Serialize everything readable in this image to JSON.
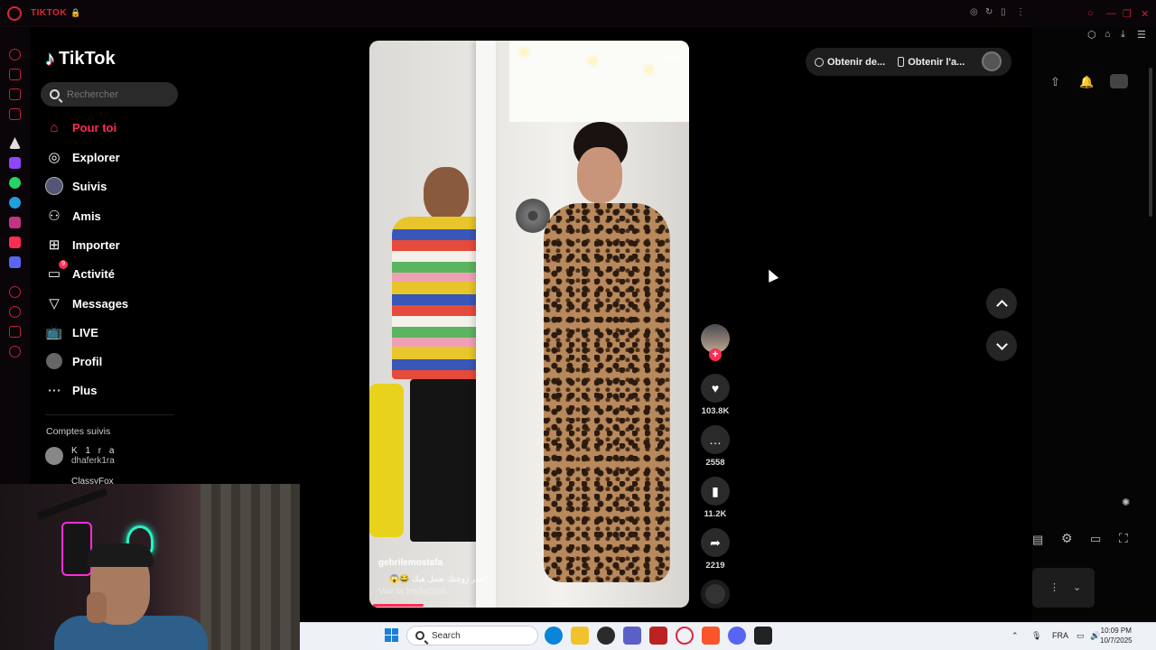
{
  "browser": {
    "tab_title": "TIKTOK",
    "lock_icon": "lock-icon"
  },
  "sidebar": {
    "logo_text": "TikTok",
    "search_placeholder": "Rechercher",
    "items": [
      {
        "label": "Pour toi",
        "icon": "home-icon",
        "active": true
      },
      {
        "label": "Explorer",
        "icon": "compass-icon"
      },
      {
        "label": "Suivis",
        "icon": "avatar-icon"
      },
      {
        "label": "Amis",
        "icon": "friends-icon"
      },
      {
        "label": "Importer",
        "icon": "upload-icon"
      },
      {
        "label": "Activité",
        "icon": "inbox-icon",
        "badge": "9"
      },
      {
        "label": "Messages",
        "icon": "send-icon"
      },
      {
        "label": "LIVE",
        "icon": "live-icon"
      },
      {
        "label": "Profil",
        "icon": "profile-icon"
      },
      {
        "label": "Plus",
        "icon": "more-icon"
      }
    ],
    "followed_title": "Comptes suivis",
    "accounts": [
      {
        "name": "K 1 r a",
        "handle": "dhaferk1ra"
      },
      {
        "name": "ClassyFox",
        "handle": ""
      }
    ]
  },
  "video": {
    "author": "gebrilemostafa",
    "caption": "احذر زوجتك تعمل هيك 😂😱",
    "translate": "Voir la traduction",
    "progress": 0.15
  },
  "actions": {
    "likes": "103.8K",
    "comments": "2558",
    "saves": "11.2K",
    "shares": "2219"
  },
  "top_pill": {
    "item1": "Obtenir de...",
    "item2": "Obtenir l'a..."
  },
  "taskbar": {
    "search": "Search",
    "lang": "FRA",
    "time": "10:09 PM",
    "date": "10/7/2025"
  }
}
